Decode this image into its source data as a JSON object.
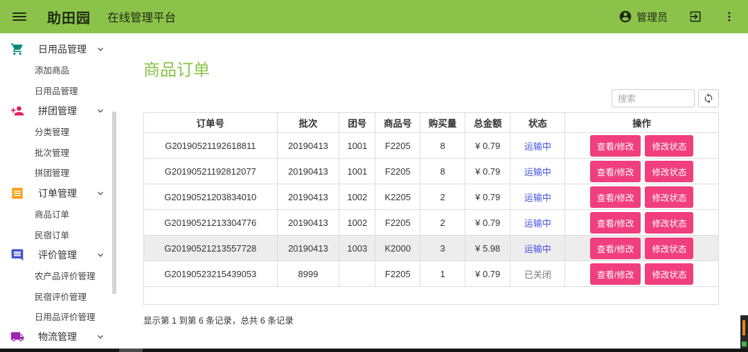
{
  "header": {
    "brand": "助田园",
    "subtitle": "在线管理平台",
    "user_label": "管理员",
    "icons": [
      "menu-icon",
      "account-circle-icon",
      "logout-icon",
      "more-vert-icon"
    ]
  },
  "sidebar": {
    "sections": [
      {
        "key": "daily-goods-management",
        "label": "日用品管理",
        "icon": "cart-icon",
        "color": "#00897b",
        "children": [
          {
            "key": "add-product",
            "label": "添加商品"
          },
          {
            "key": "daily-goods-manage",
            "label": "日用品管理"
          }
        ]
      },
      {
        "key": "group-buy-management",
        "label": "拼团管理",
        "icon": "person-add-icon",
        "color": "#e91e63",
        "children": [
          {
            "key": "category-manage",
            "label": "分类管理"
          },
          {
            "key": "batch-manage",
            "label": "批次管理"
          },
          {
            "key": "group-manage",
            "label": "拼团管理"
          }
        ]
      },
      {
        "key": "order-management",
        "label": "订单管理",
        "icon": "receipt-icon",
        "color": "#ff9800",
        "children": [
          {
            "key": "product-orders",
            "label": "商品订单"
          },
          {
            "key": "homestay-orders",
            "label": "民宿订单"
          }
        ]
      },
      {
        "key": "review-management",
        "label": "评价管理",
        "icon": "chat-icon",
        "color": "#4453c7",
        "children": [
          {
            "key": "farm-product-review",
            "label": "农产品评价管理"
          },
          {
            "key": "homestay-review",
            "label": "民宿评价管理"
          },
          {
            "key": "daily-goods-review",
            "label": "日用品评价管理"
          }
        ]
      },
      {
        "key": "logistics-management",
        "label": "物流管理",
        "icon": "truck-icon",
        "color": "#9c27b0",
        "children": []
      }
    ]
  },
  "main": {
    "title": "商品订单",
    "search_placeholder": "搜索",
    "refresh_icon": "sync-icon",
    "table": {
      "headers": [
        "订单号",
        "批次",
        "团号",
        "商品号",
        "购买量",
        "总金额",
        "状态",
        "操作"
      ],
      "col_widths_pct": [
        23.2,
        10.8,
        6.3,
        7.8,
        7.8,
        7.9,
        9.5,
        26.7
      ],
      "action_labels": [
        "查看/修改",
        "修改状态"
      ],
      "rows": [
        {
          "order_id": "G20190521192618811",
          "batch": "20190413",
          "group": "1001",
          "product": "F2205",
          "qty": "8",
          "total": "¥ 0.79",
          "status": "运输中",
          "status_type": "shipping",
          "highlighted": false
        },
        {
          "order_id": "G20190521192812077",
          "batch": "20190413",
          "group": "1001",
          "product": "F2205",
          "qty": "8",
          "total": "¥ 0.79",
          "status": "运输中",
          "status_type": "shipping",
          "highlighted": false
        },
        {
          "order_id": "G20190521203834010",
          "batch": "20190413",
          "group": "1002",
          "product": "K2205",
          "qty": "2",
          "total": "¥ 0.79",
          "status": "运输中",
          "status_type": "shipping",
          "highlighted": false
        },
        {
          "order_id": "G20190521213304776",
          "batch": "20190413",
          "group": "1002",
          "product": "F2205",
          "qty": "2",
          "total": "¥ 0.79",
          "status": "运输中",
          "status_type": "shipping",
          "highlighted": false
        },
        {
          "order_id": "G20190521213557728",
          "batch": "20190413",
          "group": "1003",
          "product": "K2000",
          "qty": "3",
          "total": "¥ 5.98",
          "status": "运输中",
          "status_type": "shipping",
          "highlighted": true
        },
        {
          "order_id": "G20190523215439053",
          "batch": "8999",
          "group": "",
          "product": "F2205",
          "qty": "1",
          "total": "¥ 0.79",
          "status": "已关闭",
          "status_type": "closed",
          "highlighted": false
        }
      ]
    },
    "records_note": "显示第 1 到第 6 条记录，总共 6 条记录"
  },
  "colors": {
    "header_green": "#8bc34a",
    "title_green": "#8bc34a",
    "button_pink": "#f13e7d",
    "status_shipping_blue": "#4253e0",
    "status_closed_gray": "#777777",
    "highlight_row": "#ededed",
    "table_border": "#dddddd"
  }
}
